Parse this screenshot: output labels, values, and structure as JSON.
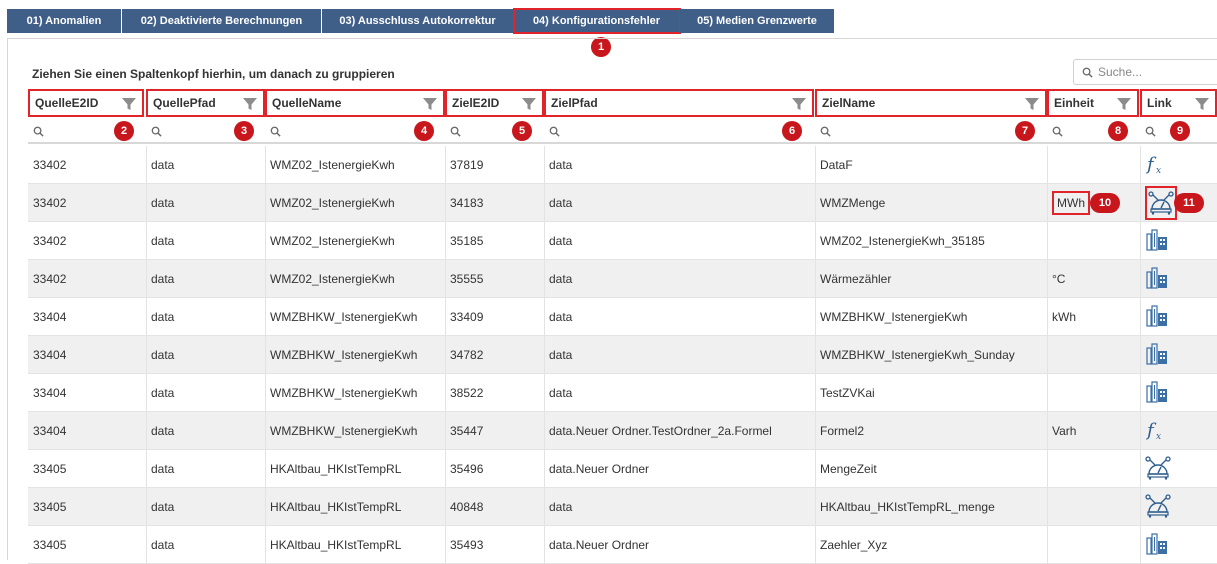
{
  "tabs": [
    {
      "label": "01) Anomalien"
    },
    {
      "label": "02) Deaktivierte Berechnungen"
    },
    {
      "label": "03) Ausschluss Autokorrektur"
    },
    {
      "label": "04) Konfigurationsfehler"
    },
    {
      "label": "05) Medien Grenzwerte"
    }
  ],
  "group_hint": "Ziehen Sie einen Spaltenkopf hierhin, um danach zu gruppieren",
  "search": {
    "placeholder": "Suche..."
  },
  "columns": [
    "QuelleE2ID",
    "QuellePfad",
    "QuelleName",
    "ZielE2ID",
    "ZielPfad",
    "ZielName",
    "Einheit",
    "Link"
  ],
  "callouts": [
    "1",
    "2",
    "3",
    "4",
    "5",
    "6",
    "7",
    "8",
    "9",
    "10",
    "11"
  ],
  "rows": [
    {
      "quelle_id": "33402",
      "quelle_pfad": "data",
      "quelle_name": "WMZ02_IstenergieKwh",
      "ziel_id": "37819",
      "ziel_pfad": "data",
      "ziel_name": "DataF",
      "einheit": "",
      "link_icon": "formula-icon"
    },
    {
      "quelle_id": "33402",
      "quelle_pfad": "data",
      "quelle_name": "WMZ02_IstenergieKwh",
      "ziel_id": "34183",
      "ziel_pfad": "data",
      "ziel_name": "WMZMenge",
      "einheit": "MWh",
      "link_icon": "meter-node-icon"
    },
    {
      "quelle_id": "33402",
      "quelle_pfad": "data",
      "quelle_name": "WMZ02_IstenergieKwh",
      "ziel_id": "35185",
      "ziel_pfad": "data",
      "ziel_name": "WMZ02_IstenergieKwh_35185",
      "einheit": "",
      "link_icon": "building-icon"
    },
    {
      "quelle_id": "33402",
      "quelle_pfad": "data",
      "quelle_name": "WMZ02_IstenergieKwh",
      "ziel_id": "35555",
      "ziel_pfad": "data",
      "ziel_name": "Wärmezähler",
      "einheit": "°C",
      "link_icon": "building-icon"
    },
    {
      "quelle_id": "33404",
      "quelle_pfad": "data",
      "quelle_name": "WMZBHKW_IstenergieKwh",
      "ziel_id": "33409",
      "ziel_pfad": "data",
      "ziel_name": "WMZBHKW_IstenergieKwh",
      "einheit": "kWh",
      "link_icon": "building-icon"
    },
    {
      "quelle_id": "33404",
      "quelle_pfad": "data",
      "quelle_name": "WMZBHKW_IstenergieKwh",
      "ziel_id": "34782",
      "ziel_pfad": "data",
      "ziel_name": "WMZBHKW_IstenergieKwh_Sunday",
      "einheit": "",
      "link_icon": "building-icon"
    },
    {
      "quelle_id": "33404",
      "quelle_pfad": "data",
      "quelle_name": "WMZBHKW_IstenergieKwh",
      "ziel_id": "38522",
      "ziel_pfad": "data",
      "ziel_name": "TestZVKai",
      "einheit": "",
      "link_icon": "building-icon"
    },
    {
      "quelle_id": "33404",
      "quelle_pfad": "data",
      "quelle_name": "WMZBHKW_IstenergieKwh",
      "ziel_id": "35447",
      "ziel_pfad": "data.Neuer Ordner.TestOrdner_2a.Formel",
      "ziel_name": "Formel2",
      "einheit": "Varh",
      "link_icon": "formula-icon"
    },
    {
      "quelle_id": "33405",
      "quelle_pfad": "data",
      "quelle_name": "HKAltbau_HKIstTempRL",
      "ziel_id": "35496",
      "ziel_pfad": "data.Neuer Ordner",
      "ziel_name": "MengeZeit",
      "einheit": "",
      "link_icon": "meter-node-icon"
    },
    {
      "quelle_id": "33405",
      "quelle_pfad": "data",
      "quelle_name": "HKAltbau_HKIstTempRL",
      "ziel_id": "40848",
      "ziel_pfad": "data",
      "ziel_name": "HKAltbau_HKIstTempRL_menge",
      "einheit": "",
      "link_icon": "meter-node-icon"
    },
    {
      "quelle_id": "33405",
      "quelle_pfad": "data",
      "quelle_name": "HKAltbau_HKIstTempRL",
      "ziel_id": "35493",
      "ziel_pfad": "data.Neuer Ordner",
      "ziel_name": "Zaehler_Xyz",
      "einheit": "",
      "link_icon": "building-icon"
    }
  ],
  "colors": {
    "tab_bg": "#3f5e88",
    "callout": "#c8161d",
    "highlight": "#e0242a",
    "icon": "#2d5d8f"
  }
}
